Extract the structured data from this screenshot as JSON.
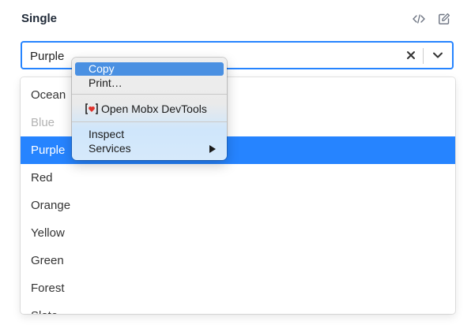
{
  "header": {
    "title": "Single",
    "code_icon": "code-icon",
    "edit_icon": "edit-icon"
  },
  "select": {
    "value": "Purple",
    "clear_icon": "close-icon",
    "dropdown_icon": "chevron-down-icon",
    "accent_color": "#2684ff"
  },
  "options": [
    {
      "label": "Ocean",
      "state": "normal"
    },
    {
      "label": "Blue",
      "state": "disabled"
    },
    {
      "label": "Purple",
      "state": "selected"
    },
    {
      "label": "Red",
      "state": "normal"
    },
    {
      "label": "Orange",
      "state": "normal"
    },
    {
      "label": "Yellow",
      "state": "normal"
    },
    {
      "label": "Green",
      "state": "normal"
    },
    {
      "label": "Forest",
      "state": "normal"
    },
    {
      "label": "Slate",
      "state": "normal"
    }
  ],
  "context_menu": {
    "copy": "Copy",
    "print": "Print…",
    "mobx": "Open Mobx DevTools",
    "mobx_icon": "mobx-icon",
    "inspect": "Inspect",
    "services": "Services",
    "highlight_color": "#4a90e2"
  }
}
